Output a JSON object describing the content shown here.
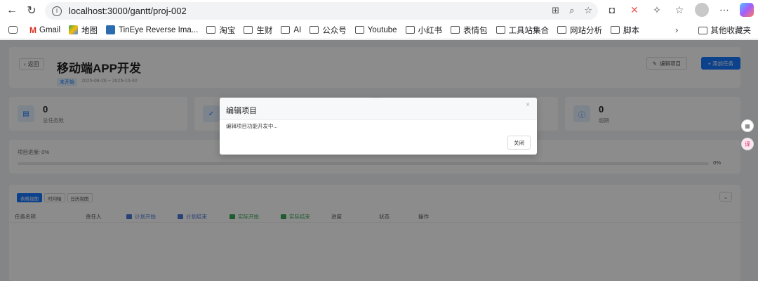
{
  "browser": {
    "url": "localhost:3000/gantt/proj-002",
    "bookmarks": [
      "Gmail",
      "地图",
      "TinEye Reverse Ima...",
      "淘宝",
      "生财",
      "AI",
      "公众号",
      "Youtube",
      "小红书",
      "表情包",
      "工具站集合",
      "网站分析",
      "脚本"
    ],
    "other_bookmarks": "其他收藏夹"
  },
  "header": {
    "back_label": "返回",
    "title": "移动端APP开发",
    "status": "未开始",
    "date_range": "2025-08-26 ~ 2025-10-30",
    "edit_label": "编辑项目",
    "add_label": "+ 添加任务"
  },
  "stats": [
    {
      "value": "0",
      "label": "总任务数",
      "color": "#1677ff",
      "bg": "#e6f0ff"
    },
    {
      "value": "0",
      "label": "超期",
      "color": "#1677ff",
      "bg": "#e6f0ff"
    }
  ],
  "progress": {
    "label": "项目进度: 0%",
    "value_text": "0%",
    "value": 0
  },
  "views": [
    "表格视图",
    "时间轴",
    "日历视图"
  ],
  "table_headers": {
    "name": "任务名称",
    "owner": "责任人",
    "plan_start": "计划开始",
    "plan_end": "计划结束",
    "actual_start": "实际开始",
    "actual_end": "实际结束",
    "progress": "进度",
    "status": "状态",
    "actions": "操作"
  },
  "modal": {
    "title": "编辑项目",
    "body": "编辑项目功能开发中...",
    "close_label": "关闭"
  },
  "colors": {
    "primary": "#1677ff",
    "plan": "#4a78d8",
    "actual": "#3aa655"
  }
}
